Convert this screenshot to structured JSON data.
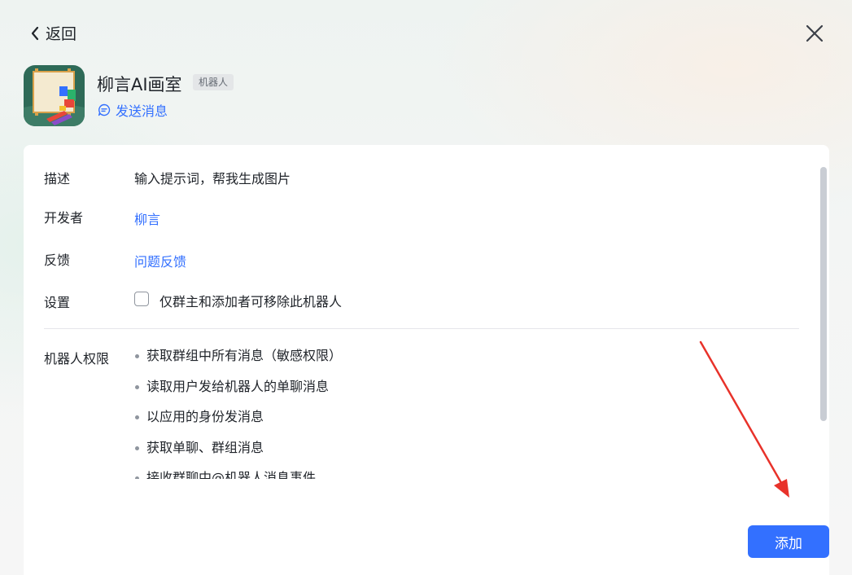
{
  "header": {
    "back_label": "返回",
    "back_icon": "chevron-left-icon",
    "close_icon": "close-icon"
  },
  "app": {
    "name": "柳言AI画室",
    "badge": "机器人",
    "send_message_label": "发送消息",
    "send_message_icon": "message-icon",
    "icon": "easel-painting-icon"
  },
  "details": {
    "description_label": "描述",
    "description_value": "输入提示词，帮我生成图片",
    "developer_label": "开发者",
    "developer_value": "柳言",
    "feedback_label": "反馈",
    "feedback_value": "问题反馈",
    "settings_label": "设置",
    "settings_checkbox_label": "仅群主和添加者可移除此机器人",
    "settings_checked": false
  },
  "permissions": {
    "label": "机器人权限",
    "items": [
      "获取群组中所有消息（敏感权限）",
      "读取用户发给机器人的单聊消息",
      "以应用的身份发消息",
      "获取单聊、群组消息",
      "接收群聊中@机器人消息事件"
    ]
  },
  "actions": {
    "add_label": "添加"
  },
  "colors": {
    "accent": "#3370ff",
    "annotation_arrow": "#e8322a"
  }
}
